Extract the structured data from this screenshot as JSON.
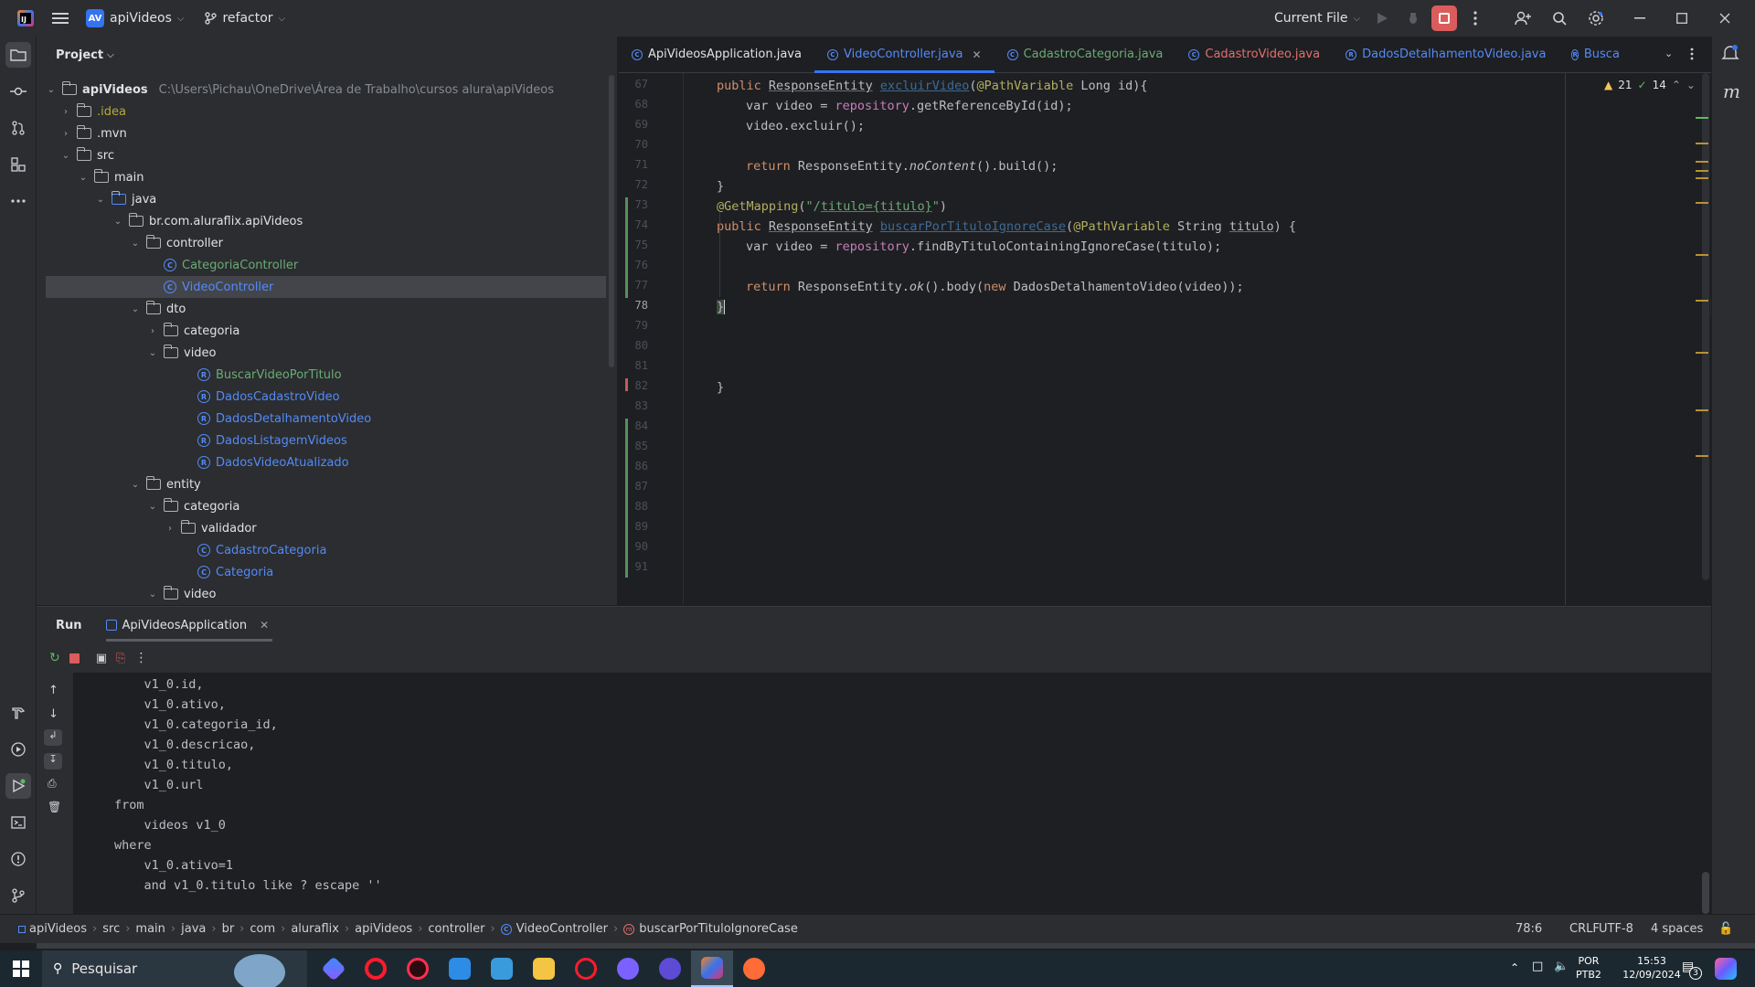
{
  "titlebar": {
    "project_badge": "AV",
    "project_name": "apiVideos",
    "branch": "refactor",
    "run_config": "Current File"
  },
  "project_panel": {
    "title": "Project",
    "root_name": "apiVideos",
    "root_path": "C:\\Users\\Pichau\\OneDrive\\Área de Trabalho\\cursos alura\\apiVideos",
    "items": [
      {
        "label": ".idea"
      },
      {
        "label": ".mvn"
      },
      {
        "label": "src"
      },
      {
        "label": "main"
      },
      {
        "label": "java"
      },
      {
        "label": "br.com.aluraflix.apiVideos"
      },
      {
        "label": "controller"
      },
      {
        "label": "CategoriaController"
      },
      {
        "label": "VideoController"
      },
      {
        "label": "dto"
      },
      {
        "label": "categoria"
      },
      {
        "label": "video"
      },
      {
        "label": "BuscarVideoPorTitulo"
      },
      {
        "label": "DadosCadastroVideo"
      },
      {
        "label": "DadosDetalhamentoVideo"
      },
      {
        "label": "DadosListagemVideos"
      },
      {
        "label": "DadosVideoAtualizado"
      },
      {
        "label": "entity"
      },
      {
        "label": "categoria"
      },
      {
        "label": "validador"
      },
      {
        "label": "CadastroCategoria"
      },
      {
        "label": "Categoria"
      },
      {
        "label": "video"
      }
    ]
  },
  "editor": {
    "tabs": [
      {
        "label": "ApiVideosApplication.java"
      },
      {
        "label": "VideoController.java"
      },
      {
        "label": "CadastroCategoria.java"
      },
      {
        "label": "CadastroVideo.java"
      },
      {
        "label": "DadosDetalhamentoVideo.java"
      },
      {
        "label": "Busca"
      }
    ],
    "warnings": "21",
    "checks": "14",
    "line_numbers": [
      "67",
      "68",
      "69",
      "70",
      "71",
      "72",
      "73",
      "74",
      "75",
      "76",
      "77",
      "78",
      "79",
      "80",
      "81",
      "82",
      "83",
      "84",
      "85",
      "86",
      "87",
      "88",
      "89",
      "90",
      "91"
    ],
    "code": {
      "l67_a": "public ",
      "l67_b": "ResponseEntity",
      "l67_c": "excluirVideo",
      "l67_d": "(",
      "l67_e": "@PathVariable",
      "l67_f": " Long id){",
      "l68_a": "var video = ",
      "l68_b": "repository",
      "l68_c": ".getReferenceById(id);",
      "l69": "video.excluir();",
      "l71_a": "return ",
      "l71_b": "ResponseEntity.",
      "l71_c": "noContent",
      "l71_d": "().build();",
      "l72": "}",
      "l73_a": "@GetMapping",
      "l73_b": "(",
      "l73_c": "\"/",
      "l73_d": "titulo={titulo}",
      "l73_e": "\"",
      "l73_f": ")",
      "l74_a": "public ",
      "l74_b": "ResponseEntity",
      "l74_c": "buscarPorTituloIgnoreCase",
      "l74_d": "(",
      "l74_e": "@PathVariable",
      "l74_f": " String ",
      "l74_g": "titulo",
      "l74_h": ") {",
      "l75_a": "var video = ",
      "l75_b": "repository",
      "l75_c": ".findByTituloContainingIgnoreCase(titulo);",
      "l77_a": "return ",
      "l77_b": "ResponseEntity.",
      "l77_c": "ok",
      "l77_d": "().body(",
      "l77_e": "new ",
      "l77_f": "DadosDetalhamentoVideo(video));",
      "l78": "}",
      "l82": "}"
    }
  },
  "run_panel": {
    "title": "Run",
    "tab": "ApiVideosApplication",
    "console": [
      "    v1_0.id,",
      "    v1_0.ativo,",
      "    v1_0.categoria_id,",
      "    v1_0.descricao,",
      "    v1_0.titulo,",
      "    v1_0.url",
      "from",
      "    videos v1_0",
      "where",
      "    v1_0.ativo=1",
      "    and v1_0.titulo like ? escape ''"
    ]
  },
  "statusbar": {
    "crumbs": [
      "apiVideos",
      "src",
      "main",
      "java",
      "br",
      "com",
      "aluraflix",
      "apiVideos",
      "controller",
      "VideoController",
      "buscarPorTituloIgnoreCase"
    ],
    "position": "78:6",
    "line_sep": "CRLF",
    "encoding": "UTF-8",
    "indent": "4 spaces"
  },
  "taskbar": {
    "search": "Pesquisar",
    "lang1": "POR",
    "lang2": "PTB2",
    "time": "15:53",
    "date": "12/09/2024",
    "notif_count": "3"
  },
  "colors": {
    "accent": "#3574f0",
    "stop": "#db5c5c",
    "warning": "#f2c55c",
    "ok": "#5fb865"
  }
}
